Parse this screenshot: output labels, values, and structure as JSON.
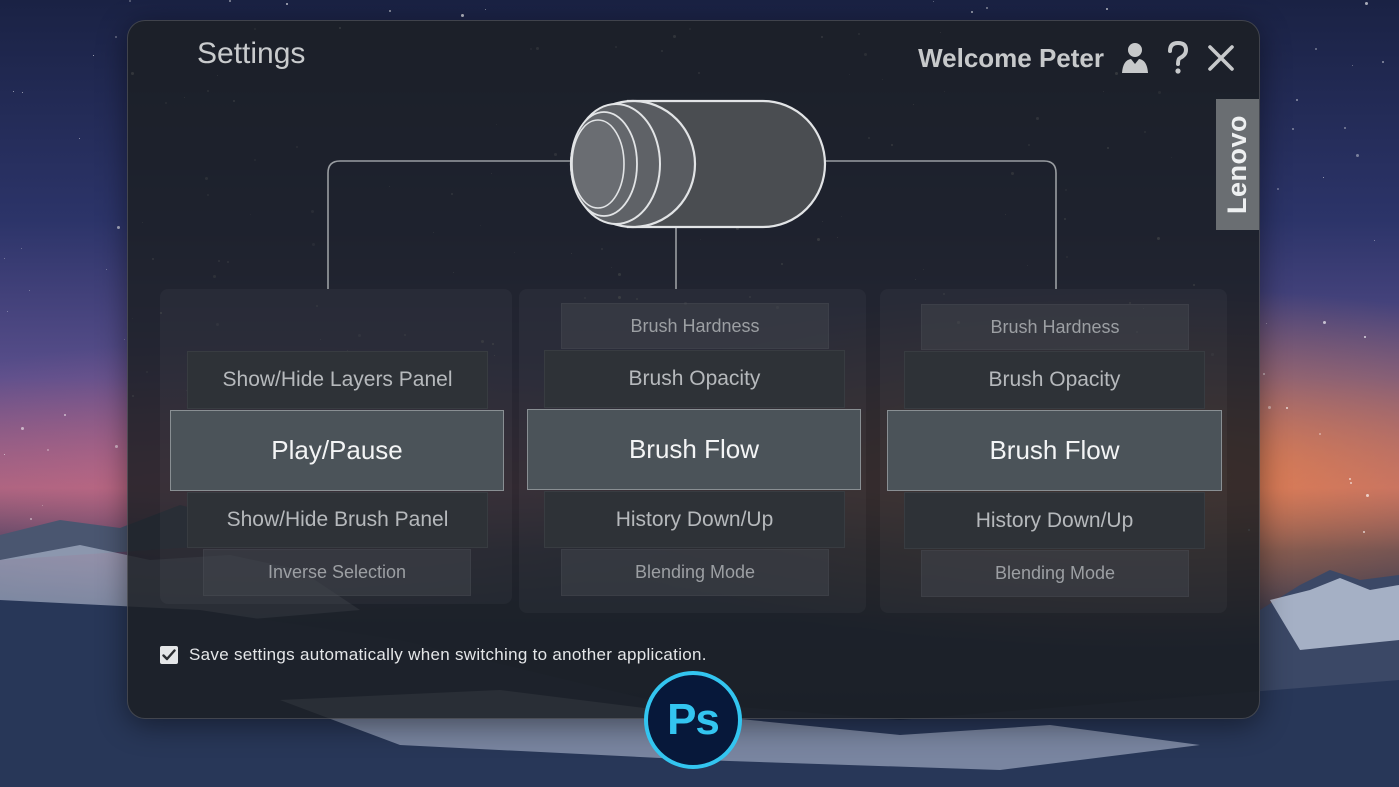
{
  "window": {
    "title": "Settings",
    "welcome": "Welcome Peter"
  },
  "brand": "Lenovo",
  "dial_columns": [
    {
      "id": "left",
      "items": [
        {
          "label": "Show/Hide Layers Panel",
          "tier": "tier1"
        },
        {
          "label": "Play/Pause",
          "tier": "main"
        },
        {
          "label": "Show/Hide Brush Panel",
          "tier": "tier1"
        },
        {
          "label": "Inverse Selection",
          "tier": "tier2"
        }
      ]
    },
    {
      "id": "center",
      "items": [
        {
          "label": "Brush Hardness",
          "tier": "tier2"
        },
        {
          "label": "Brush Opacity",
          "tier": "tier1"
        },
        {
          "label": "Brush Flow",
          "tier": "main"
        },
        {
          "label": "History Down/Up",
          "tier": "tier1"
        },
        {
          "label": "Blending Mode",
          "tier": "tier2"
        }
      ]
    },
    {
      "id": "right",
      "items": [
        {
          "label": "Brush Hardness",
          "tier": "tier2"
        },
        {
          "label": "Brush Opacity",
          "tier": "tier1"
        },
        {
          "label": "Brush Flow",
          "tier": "main"
        },
        {
          "label": "History Down/Up",
          "tier": "tier1"
        },
        {
          "label": "Blending Mode",
          "tier": "tier2"
        }
      ]
    }
  ],
  "save_settings": {
    "checked": true,
    "label": "Save settings automatically when switching to another application."
  },
  "active_app": {
    "label": "Ps",
    "accent": "#33c5f0"
  },
  "icons": {
    "user": "user-icon",
    "help": "help-icon",
    "close": "close-icon",
    "check": "checkmark-icon"
  }
}
